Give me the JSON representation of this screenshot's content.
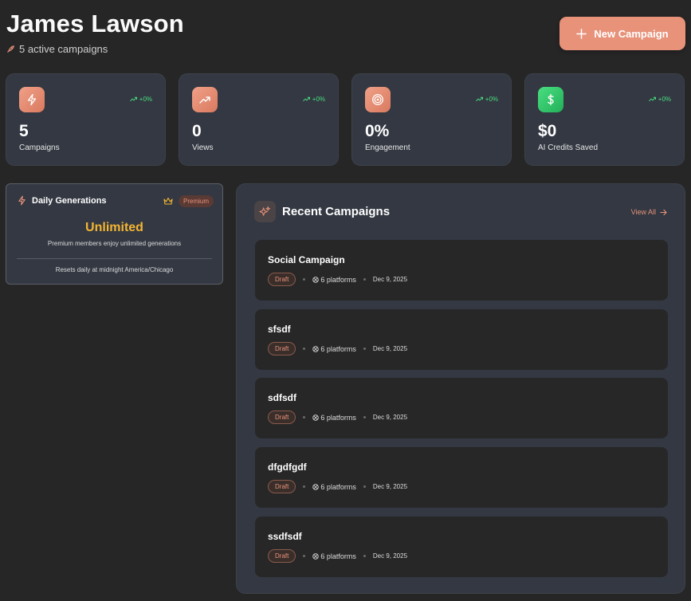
{
  "header": {
    "title": "James Lawson",
    "subtitle": "5 active campaigns",
    "new_campaign_label": "New Campaign"
  },
  "stats": [
    {
      "icon": "zap-icon",
      "value": "5",
      "label": "Campaigns",
      "trend": "+0%",
      "color": "#e8927a"
    },
    {
      "icon": "trending-up-icon",
      "value": "0",
      "label": "Views",
      "trend": "+0%",
      "color": "#e8927a"
    },
    {
      "icon": "target-icon",
      "value": "0%",
      "label": "Engagement",
      "trend": "+0%",
      "color": "#e8927a"
    },
    {
      "icon": "dollar-icon",
      "value": "$0",
      "label": "AI Credits Saved",
      "trend": "+0%",
      "color": "#4ade80"
    }
  ],
  "daily": {
    "title": "Daily Generations",
    "badge": "Premium",
    "headline": "Unlimited",
    "description": "Premium members enjoy unlimited generations",
    "reset": "Resets daily at midnight America/Chicago"
  },
  "recent": {
    "title": "Recent Campaigns",
    "view_all": "View All",
    "campaigns": [
      {
        "name": "Social Campaign",
        "status": "Draft",
        "platforms": "6 platforms",
        "date": "Dec 9, 2025"
      },
      {
        "name": "sfsdf",
        "status": "Draft",
        "platforms": "6 platforms",
        "date": "Dec 9, 2025"
      },
      {
        "name": "sdfsdf",
        "status": "Draft",
        "platforms": "6 platforms",
        "date": "Dec 9, 2025"
      },
      {
        "name": "dfgdfgdf",
        "status": "Draft",
        "platforms": "6 platforms",
        "date": "Dec 9, 2025"
      },
      {
        "name": "ssdfsdf",
        "status": "Draft",
        "platforms": "6 platforms",
        "date": "Dec 9, 2025"
      }
    ]
  },
  "colors": {
    "accent": "#e8927a",
    "success": "#4ade80",
    "gold": "#f5b533",
    "background": "#262626",
    "card": "#333842"
  }
}
